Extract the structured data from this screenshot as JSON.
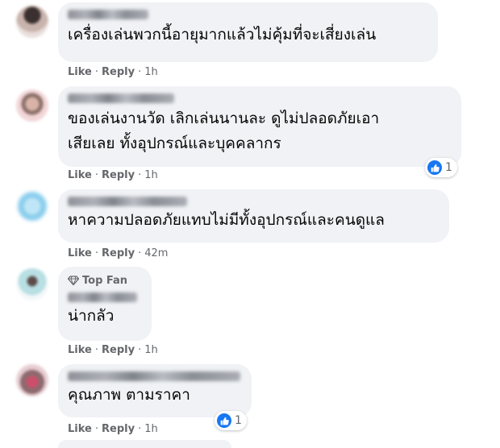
{
  "comments": [
    {
      "text": "เครื่องเล่นพวกนี้อายุมากแล้วไม่คุ้มที่จะเสี่ยงเล่น",
      "like_label": "Like",
      "reply_label": "Reply",
      "time": "1h",
      "reaction_count": null,
      "top_fan": null
    },
    {
      "text": "ของเล่นงานวัด เลิกเล่นนานละ ดูไม่ปลอดภัยเอา\nเสียเลย ทั้งอุปกรณ์และบุคคลากร",
      "like_label": "Like",
      "reply_label": "Reply",
      "time": "1h",
      "reaction_count": "1",
      "top_fan": null
    },
    {
      "text": "หาความปลอดภัยแทบไม่มีทั้งอุปกรณ์และคนดูแล",
      "like_label": "Like",
      "reply_label": "Reply",
      "time": "42m",
      "reaction_count": null,
      "top_fan": null
    },
    {
      "text": "น่ากลัว",
      "like_label": "Like",
      "reply_label": "Reply",
      "time": "1h",
      "reaction_count": null,
      "top_fan": "Top Fan"
    },
    {
      "text": "คุณภาพ ตามราคา",
      "like_label": "Like",
      "reply_label": "Reply",
      "time": "1h",
      "reaction_count": "1",
      "top_fan": null
    }
  ],
  "colors": {
    "bubble": "#f0f2f5",
    "meta_text": "#65676b",
    "like_blue": "#1877f2"
  },
  "icons": [
    "avatar-blurred",
    "name-blurred",
    "like-reaction-icon",
    "diamond-icon"
  ]
}
